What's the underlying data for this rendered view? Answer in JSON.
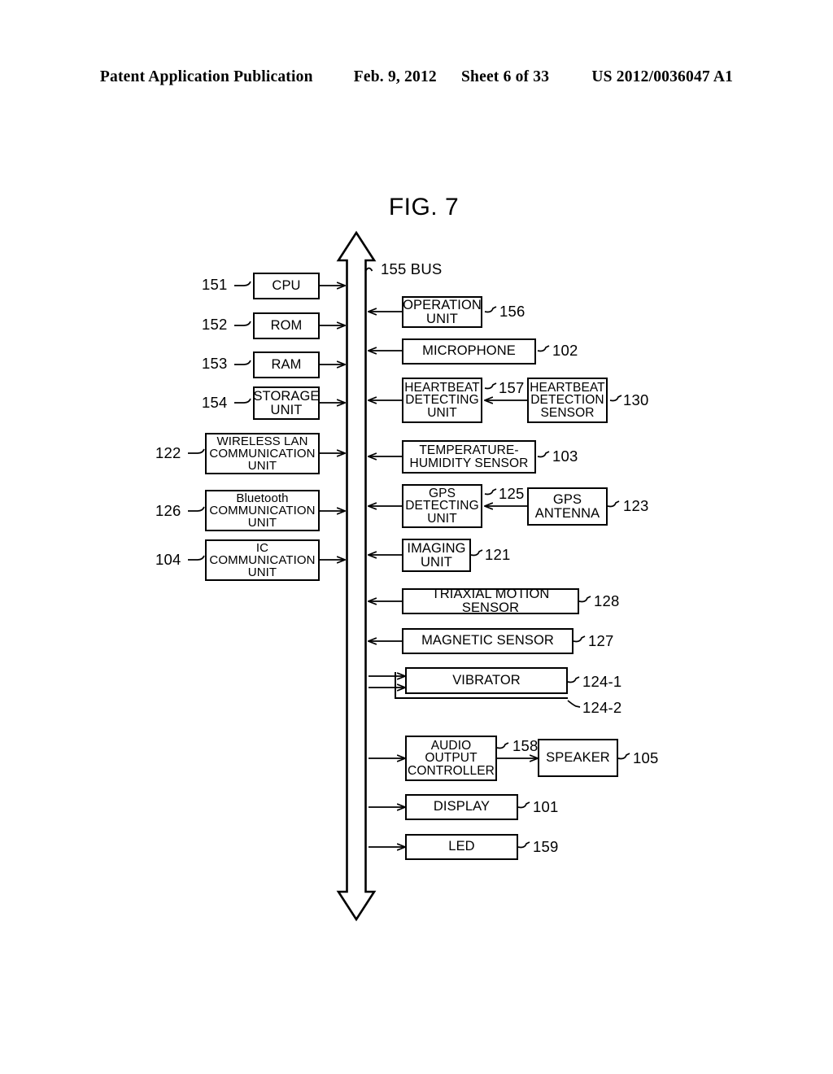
{
  "header": {
    "publication": "Patent Application Publication",
    "date": "Feb. 9, 2012",
    "sheet": "Sheet 6 of 33",
    "docnum": "US 2012/0036047 A1"
  },
  "figure": {
    "title": "FIG. 7",
    "bus_label": "155 BUS"
  },
  "blocks": {
    "cpu": {
      "label": "CPU",
      "ref": "151"
    },
    "rom": {
      "label": "ROM",
      "ref": "152"
    },
    "ram": {
      "label": "RAM",
      "ref": "153"
    },
    "storage": {
      "label": "STORAGE\nUNIT",
      "ref": "154"
    },
    "wlan": {
      "label": "WIRELESS LAN\nCOMMUNICATION\nUNIT",
      "ref": "122"
    },
    "bluetooth": {
      "label": "Bluetooth\nCOMMUNICATION\nUNIT",
      "ref": "126"
    },
    "ic": {
      "label": "IC\nCOMMUNICATION\nUNIT",
      "ref": "104"
    },
    "operation": {
      "label": "OPERATION\nUNIT",
      "ref": "156"
    },
    "microphone": {
      "label": "MICROPHONE",
      "ref": "102"
    },
    "hb_unit": {
      "label": "HEARTBEAT\nDETECTING\nUNIT",
      "ref": "157"
    },
    "hb_sensor": {
      "label": "HEARTBEAT\nDETECTION\nSENSOR",
      "ref": "130"
    },
    "temp_hum": {
      "label": "TEMPERATURE-\nHUMIDITY SENSOR",
      "ref": "103"
    },
    "gps_unit": {
      "label": "GPS\nDETECTING\nUNIT",
      "ref": "125"
    },
    "gps_ant": {
      "label": "GPS\nANTENNA",
      "ref": "123"
    },
    "imaging": {
      "label": "IMAGING\nUNIT",
      "ref": "121"
    },
    "triaxial": {
      "label": "TRIAXIAL MOTION SENSOR",
      "ref": "128"
    },
    "magnetic": {
      "label": "MAGNETIC SENSOR",
      "ref": "127"
    },
    "vibrator": {
      "label": "VIBRATOR",
      "ref": "124-1",
      "ref2": "124-2"
    },
    "audio": {
      "label": "AUDIO\nOUTPUT\nCONTROLLER",
      "ref": "158"
    },
    "speaker": {
      "label": "SPEAKER",
      "ref": "105"
    },
    "display": {
      "label": "DISPLAY",
      "ref": "101"
    },
    "led": {
      "label": "LED",
      "ref": "159"
    }
  },
  "colors": {
    "ink": "#000000",
    "paper": "#ffffff"
  }
}
